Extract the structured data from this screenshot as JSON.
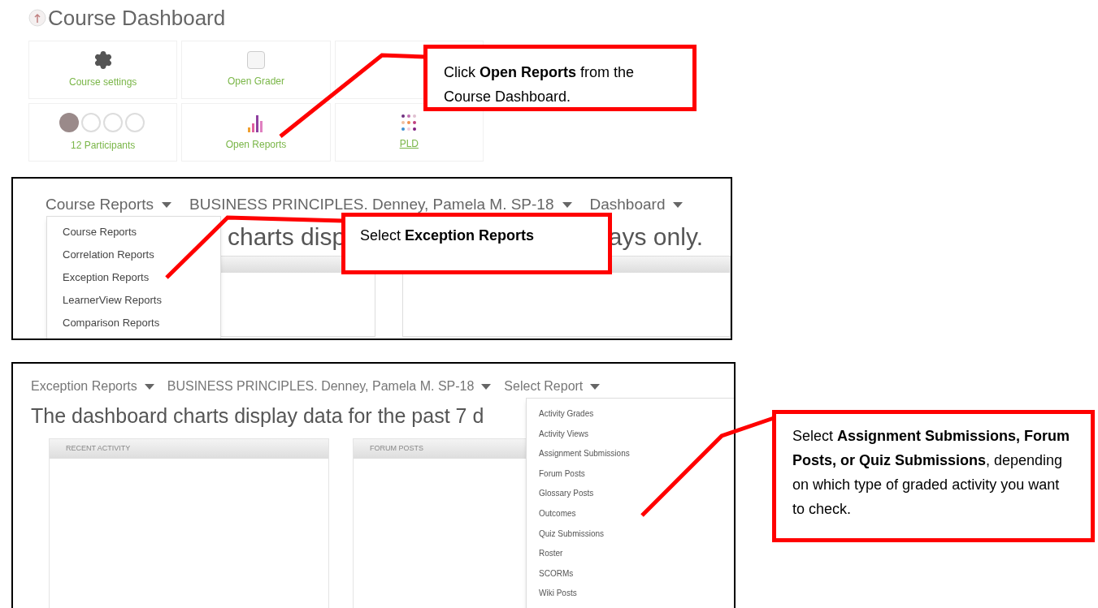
{
  "dashboard": {
    "title": "Course Dashboard",
    "rows": [
      [
        {
          "kind": "settings",
          "label": "Course settings"
        },
        {
          "kind": "grader",
          "label": "Open Grader"
        }
      ],
      [
        {
          "kind": "participants",
          "label": "12 Participants"
        },
        {
          "kind": "reports",
          "label": "Open Reports"
        },
        {
          "kind": "pld",
          "label": "PLD"
        }
      ]
    ]
  },
  "course_reports_screen": {
    "nav": [
      "Course Reports",
      "BUSINESS PRINCIPLES. Denney, Pamela M. SP-18",
      "Dashboard"
    ],
    "heading_fragments": [
      "charts disp",
      "ays only."
    ],
    "menu": [
      "Course Reports",
      "Correlation Reports",
      "Exception Reports",
      "LearnerView Reports",
      "Comparison Reports"
    ]
  },
  "exception_reports_screen": {
    "nav": [
      "Exception Reports",
      "BUSINESS PRINCIPLES. Denney, Pamela M. SP-18",
      "Select Report"
    ],
    "heading": "The dashboard charts display data for the past 7 d",
    "panels": [
      "RECENT ACTIVITY",
      "FORUM POSTS"
    ],
    "menu": [
      "Activity Grades",
      "Activity Views",
      "Assignment Submissions",
      "Forum Posts",
      "Glossary Posts",
      "Outcomes",
      "Quiz Submissions",
      "Roster",
      "SCORMs",
      "Wiki Posts"
    ]
  },
  "callouts": [
    {
      "text": "Click **Open Reports** from the Course Dashboard."
    },
    {
      "text": "Select **Exception Reports**"
    },
    {
      "text": "Select **Assignment Submissions, Forum Posts, or Quiz Submissions**, depending on which type of graded activity you want to check."
    }
  ]
}
